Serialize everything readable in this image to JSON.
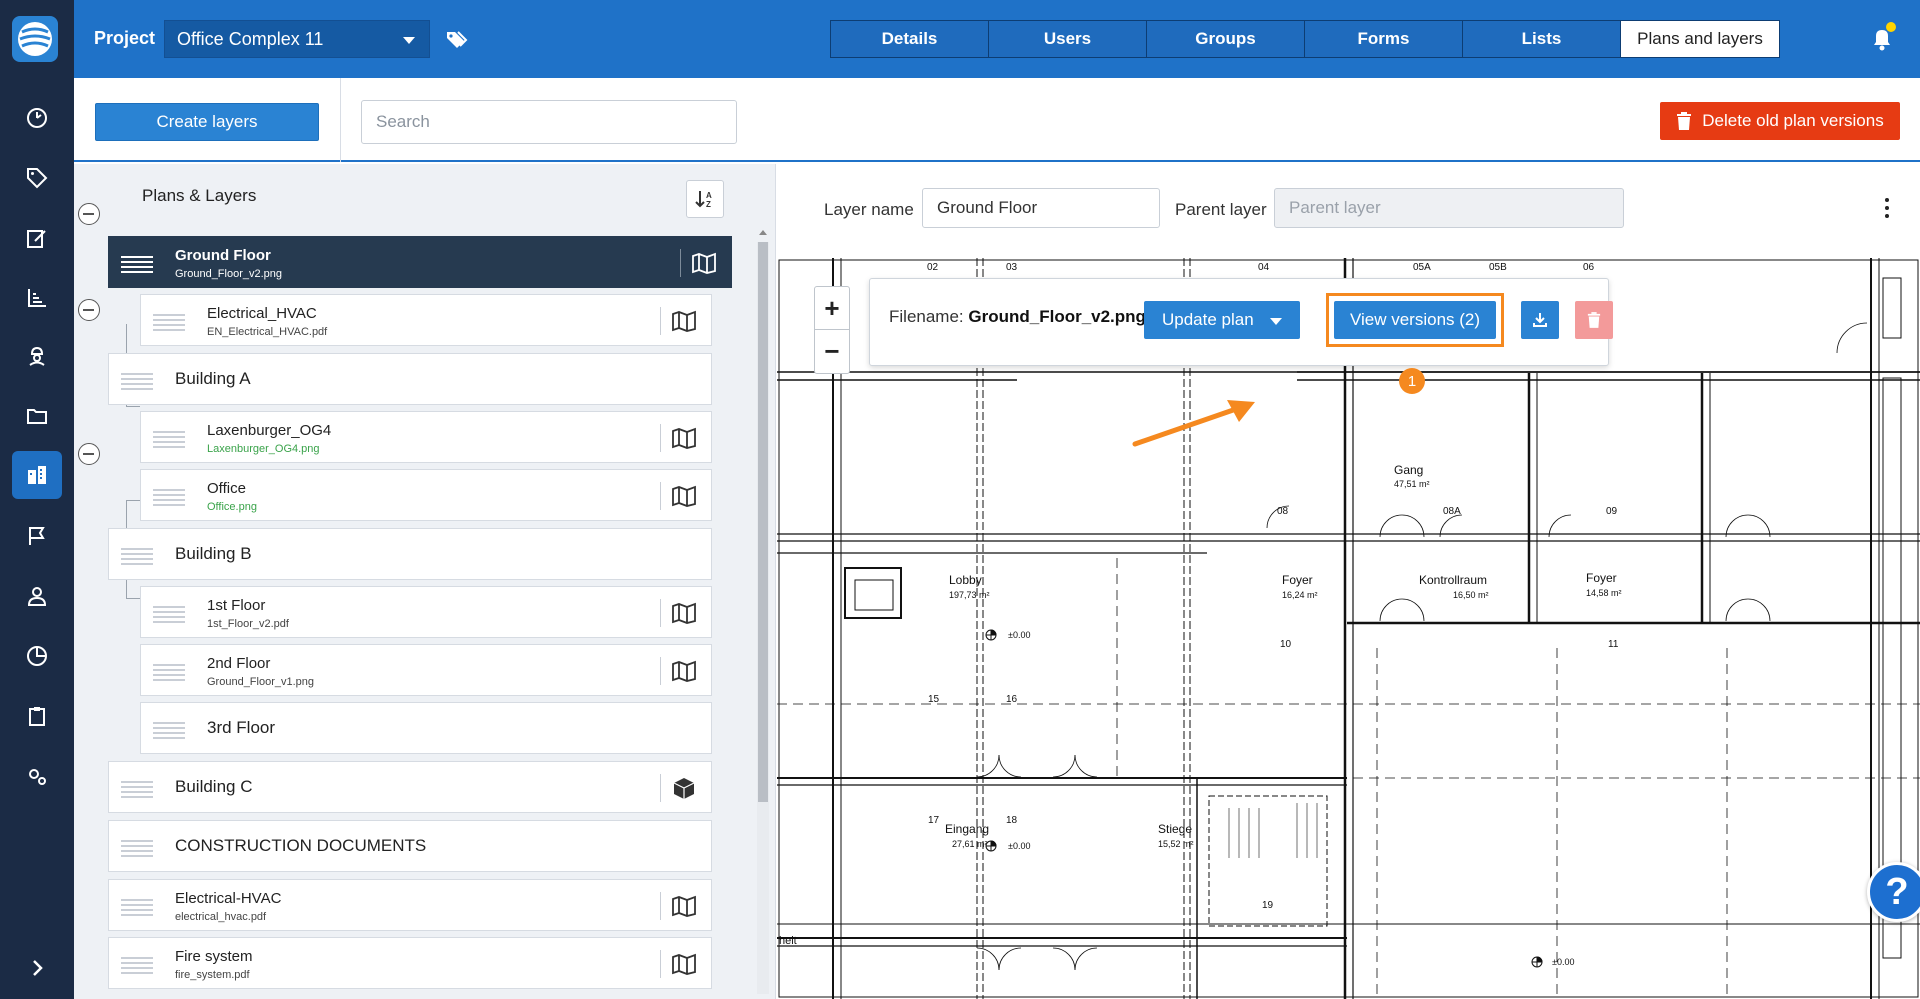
{
  "sidebar": {
    "icons": [
      "dashboard-icon",
      "tag-icon",
      "edit-form-icon",
      "chart-icon",
      "worker-icon",
      "folder-icon",
      "buildings-icon",
      "flag-icon",
      "user-icon",
      "pie-chart-icon",
      "clipboard-icon",
      "settings-icon",
      "chevron-right-icon"
    ],
    "active": "buildings-icon"
  },
  "header": {
    "project_label": "Project",
    "project_name": "Office Complex 11",
    "tabs": [
      "Details",
      "Users",
      "Groups",
      "Forms",
      "Lists",
      "Plans and layers"
    ],
    "active_tab": "Plans and layers"
  },
  "toolbar": {
    "create_label": "Create layers",
    "search_placeholder": "Search",
    "delete_label": "Delete old plan versions"
  },
  "tree": {
    "title": "Plans & Layers",
    "nodes": [
      {
        "name": "Ground Floor",
        "file": "Ground_Floor_v2.png",
        "selected": true
      },
      {
        "name": "Electrical_HVAC",
        "file": "EN_Electrical_HVAC.pdf"
      },
      {
        "name": "Building A",
        "file": ""
      },
      {
        "name": "Laxenburger_OG4",
        "file": "Laxenburger_OG4.png"
      },
      {
        "name": "Office",
        "file": "Office.png"
      },
      {
        "name": "Building B",
        "file": ""
      },
      {
        "name": "1st Floor",
        "file": "1st_Floor_v2.pdf"
      },
      {
        "name": "2nd Floor",
        "file": "Ground_Floor_v1.png"
      },
      {
        "name": "3rd Floor",
        "file": ""
      },
      {
        "name": "Building C",
        "file": ""
      },
      {
        "name": "CONSTRUCTION DOCUMENTS",
        "file": ""
      },
      {
        "name": "Electrical-HVAC",
        "file": "electrical_hvac.pdf"
      },
      {
        "name": "Fire system",
        "file": "fire_system.pdf"
      }
    ]
  },
  "layer": {
    "name_label": "Layer name",
    "name_value": "Ground Floor",
    "parent_label": "Parent layer",
    "parent_placeholder": "Parent layer"
  },
  "popup": {
    "filename_label": "Filename:",
    "filename": "Ground_Floor_v2.png",
    "update_label": "Update plan",
    "versions_label": "View versions (2)",
    "callout_number": "1"
  },
  "plan": {
    "rooms": [
      {
        "name": "Lobby",
        "area": "197,73 m²"
      },
      {
        "name": "Foyer",
        "area": "16,24 m²"
      },
      {
        "name": "Kontrollraum",
        "area": "16,50 m²"
      },
      {
        "name": "Foyer",
        "area": "14,58 m²"
      },
      {
        "name": "Gang",
        "area": "47,51 m²"
      },
      {
        "name": "Eingang",
        "area": "27,61 m²"
      },
      {
        "name": "Stiege",
        "area": "15,52 m²"
      }
    ],
    "numbers": [
      "02",
      "03",
      "04",
      "05A",
      "05B",
      "06",
      "08",
      "08A",
      "09",
      "10",
      "11",
      "15",
      "16",
      "17",
      "18",
      "19"
    ],
    "levels": [
      "±0.00",
      "±0.00",
      "±0.00"
    ],
    "partial_label": "heit"
  },
  "help": {
    "label": "?"
  }
}
